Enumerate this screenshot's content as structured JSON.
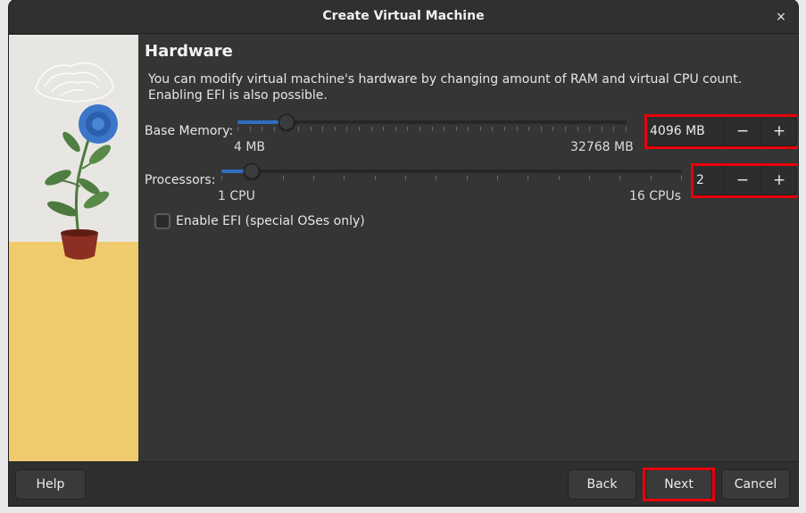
{
  "window": {
    "title": "Create Virtual Machine",
    "close_label": "×"
  },
  "page": {
    "heading": "Hardware",
    "description_line1": "You can modify virtual machine's hardware by changing amount of RAM and virtual CPU count.",
    "description_line2": "Enabling EFI is also possible."
  },
  "memory": {
    "label": "Base Memory:",
    "min_label": "4 MB",
    "max_label": "32768 MB",
    "value_text": "4096 MB",
    "value_fraction": 0.125,
    "decrement_label": "−",
    "increment_label": "+"
  },
  "processors": {
    "label": "Processors:",
    "min_label": "1 CPU",
    "max_label": "16 CPUs",
    "value_text": "2",
    "value_fraction": 0.0667,
    "decrement_label": "−",
    "increment_label": "+"
  },
  "efi": {
    "label": "Enable EFI (special OSes only)",
    "checked": false
  },
  "footer": {
    "help_label": "Help",
    "back_label": "Back",
    "next_label": "Next",
    "cancel_label": "Cancel"
  },
  "colors": {
    "accent": "#2f6fbf",
    "highlight": "#e8000b",
    "background": "#353535"
  }
}
